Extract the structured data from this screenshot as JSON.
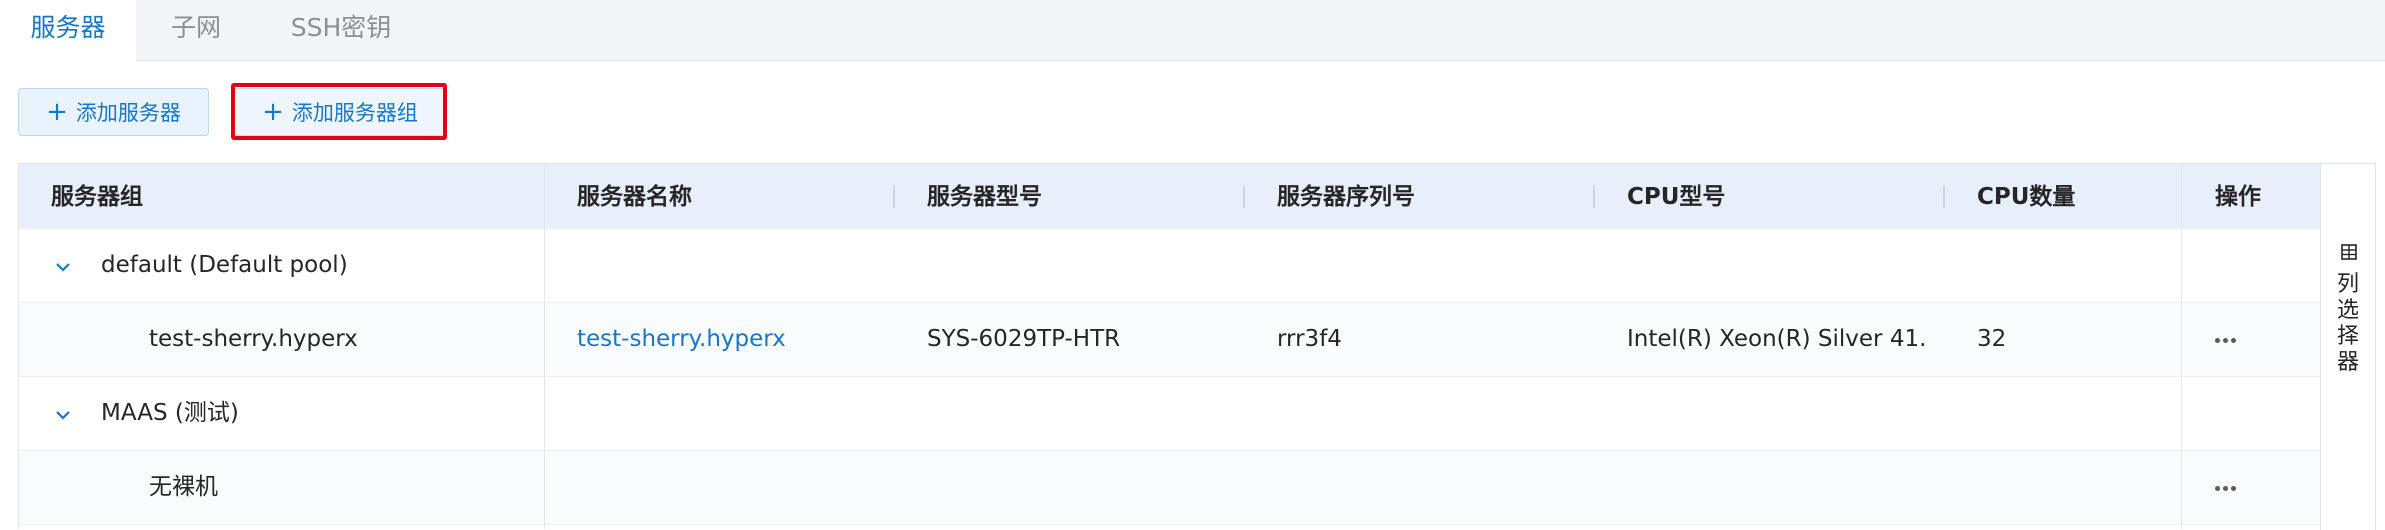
{
  "tabs": [
    {
      "label": "服务器",
      "active": true
    },
    {
      "label": "子网",
      "active": false
    },
    {
      "label": "SSH密钥",
      "active": false
    }
  ],
  "toolbar": {
    "add_server": "添加服务器",
    "add_server_group": "添加服务器组",
    "plus_icon": "plus-icon"
  },
  "table": {
    "headers": [
      "服务器组",
      "服务器名称",
      "服务器型号",
      "服务器序列号",
      "CPU型号",
      "CPU数量",
      "操作"
    ],
    "rows": [
      {
        "type": "group",
        "group": "default (Default pool)"
      },
      {
        "type": "server",
        "group": "test-sherry.hyperx",
        "name": "test-sherry.hyperx",
        "model": "SYS-6029TP-HTR",
        "serial": "rrr3f4",
        "cpu_model": "Intel(R) Xeon(R) Silver 41...",
        "cpu_count": "32",
        "has_actions": true
      },
      {
        "type": "group",
        "group": "MAAS (测试)"
      },
      {
        "type": "server",
        "group": "无裸机",
        "name": "",
        "model": "",
        "serial": "",
        "cpu_model": "",
        "cpu_count": "",
        "has_actions": true
      }
    ]
  },
  "column_selector": {
    "label": "列选择器",
    "icon": "columns-icon"
  },
  "colors": {
    "accent": "#1677c8",
    "highlight": "#e2001a",
    "header_bg": "#e9eefb"
  }
}
